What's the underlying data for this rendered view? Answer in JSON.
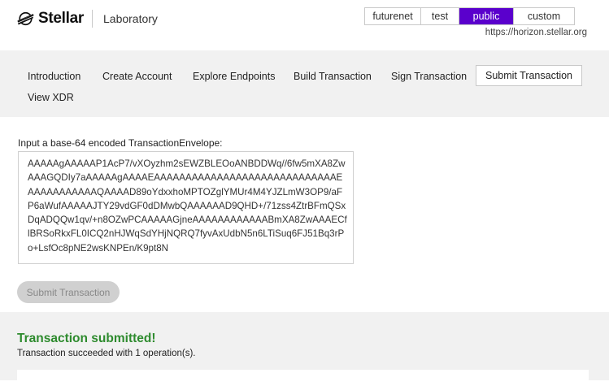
{
  "header": {
    "brand": "Stellar",
    "lab": "Laboratory",
    "logo_icon": "stellar-logo-icon",
    "networks": [
      "futurenet",
      "test",
      "public",
      "custom"
    ],
    "active_network": "public",
    "horizon_url": "https://horizon.stellar.org"
  },
  "nav": {
    "items": [
      "Introduction",
      "Create Account",
      "Explore Endpoints",
      "Build Transaction",
      "Sign Transaction",
      "Submit Transaction",
      "View XDR"
    ],
    "active": "Submit Transaction"
  },
  "main": {
    "input_label": "Input a base-64 encoded TransactionEnvelope:",
    "xdr_value": "AAAAAgAAAAAP1AcP7/vXOyzhm2sEWZBLEOoANBDDWq//6fw5mXA8ZwAAAGQDIy7aAAAAAgAAAAEAAAAAAAAAAAAAAAAAAAAAAAAAAAAAEAAAAAAAAAAAQAAAAD89oYdxxhoMPTOZglYMUr4M4YJZLmW3OP9/aFP6aWufAAAAAJTY29vdGF0dDMwbQAAAAAAD9QHD+/71zss4ZtrBFmQSxDqADQQw1qv/+n8OZwPCAAAAAGjneAAAAAAAAAAAABmXA8ZwAAAECflBRSoRkxFL0ICQ2nHJWqSdYHjNQRQ7fyvAxUdbN5n6LTiSuq6FJ51Bq3rPo+LsfOc8pNE2wsKNPEn/K9pt8N",
    "submit_label": "Submit Transaction"
  },
  "result": {
    "title": "Transaction submitted!",
    "message": "Transaction succeeded with 1 operation(s).",
    "status_color": "#2e8b2e"
  },
  "colors": {
    "accent": "#5a00cc",
    "panel_bg": "#f1f1f1"
  }
}
